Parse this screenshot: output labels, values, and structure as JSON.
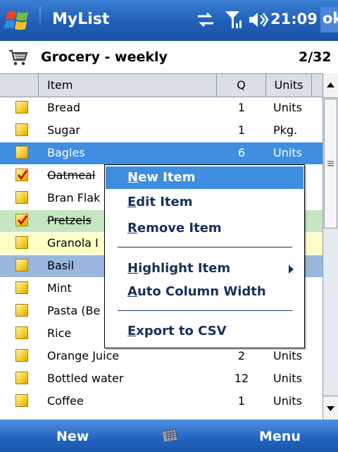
{
  "titlebar": {
    "app_title": "MyList",
    "clock": "21:09",
    "ok_label": "ok"
  },
  "list": {
    "name": "Grocery - weekly",
    "count": "2/32"
  },
  "columns": {
    "item": "Item",
    "q": "Q",
    "units": "Units"
  },
  "rows": [
    {
      "item": "Bread",
      "q": "1",
      "units": "Units",
      "checked": false,
      "highlight": "none"
    },
    {
      "item": "Sugar",
      "q": "1",
      "units": "Pkg.",
      "checked": false,
      "highlight": "none"
    },
    {
      "item": "Bagles",
      "q": "6",
      "units": "Units",
      "checked": false,
      "highlight": "selected"
    },
    {
      "item": "Oatmeal",
      "q": "",
      "units": "",
      "checked": true,
      "highlight": "none"
    },
    {
      "item": "Bran Flak",
      "q": "",
      "units": "",
      "checked": false,
      "highlight": "none"
    },
    {
      "item": "Pretzels",
      "q": "",
      "units": "",
      "checked": true,
      "highlight": "green"
    },
    {
      "item": "Granola I",
      "q": "",
      "units": "",
      "checked": false,
      "highlight": "yellow"
    },
    {
      "item": "Basil",
      "q": "",
      "units": "",
      "checked": false,
      "highlight": "steel"
    },
    {
      "item": "Mint",
      "q": "",
      "units": "",
      "checked": false,
      "highlight": "none"
    },
    {
      "item": "Pasta (Be",
      "q": "",
      "units": "",
      "checked": false,
      "highlight": "none"
    },
    {
      "item": "Rice",
      "q": "",
      "units": "",
      "checked": false,
      "highlight": "none"
    },
    {
      "item": "Orange Juice",
      "q": "2",
      "units": "Units",
      "checked": false,
      "highlight": "none"
    },
    {
      "item": "Bottled water",
      "q": "12",
      "units": "Units",
      "checked": false,
      "highlight": "none"
    },
    {
      "item": "Coffee",
      "q": "1",
      "units": "Units",
      "checked": false,
      "highlight": "none"
    }
  ],
  "menu": {
    "new_item": {
      "ul": "N",
      "rest": "ew Item"
    },
    "edit_item": {
      "ul": "E",
      "rest": "dit Item"
    },
    "remove_item": {
      "ul": "R",
      "rest": "emove Item"
    },
    "highlight_item": {
      "ul": "H",
      "rest": "ighlight Item"
    },
    "auto_column_width": {
      "ul": "A",
      "rest": "uto Column Width"
    },
    "export_csv": {
      "ul": "E",
      "rest": "xport to CSV"
    }
  },
  "softkeys": {
    "left": "New",
    "right": "Menu"
  },
  "colors": {
    "titlebar": "#1f5fb8",
    "selection": "#3f8ee0",
    "green_highlight": "#c5e6c0",
    "yellow_highlight": "#ffffc8",
    "steel_highlight": "#9ab8dd",
    "menu_text": "#16315c"
  },
  "icons": [
    "windows-flag-icon",
    "sync-icon",
    "signal-icon",
    "volume-icon",
    "cart-icon",
    "checkmark-icon",
    "keyboard-icon"
  ]
}
